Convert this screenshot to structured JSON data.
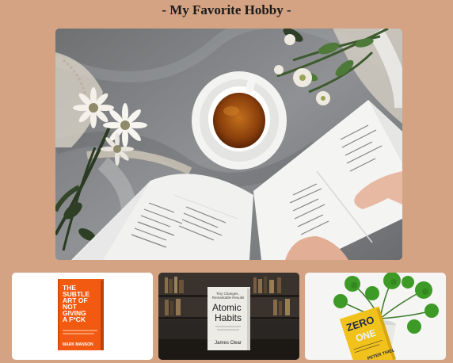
{
  "page": {
    "title": "- My Favorite Hobby -"
  },
  "hero": {
    "image": "reading-book-with-tea-photo"
  },
  "books": [
    {
      "image": "subtle-art-book-cover",
      "title_lines": [
        "THE",
        "SUBTLE",
        "ART OF",
        "NOT",
        "GIVING",
        "A F*CK"
      ],
      "author": "MARK MANSON",
      "cover_color": "#f25a12"
    },
    {
      "image": "atomic-habits-book-cover",
      "tagline_lines": [
        "Tiny Changes,",
        "Remarkable Results"
      ],
      "title_lines": [
        "Atomic",
        "Habits"
      ],
      "author": "James Clear"
    },
    {
      "image": "zero-to-one-book-cover",
      "title_lines": [
        "ZERO",
        "ONE"
      ],
      "author": "PETER THIEL",
      "cover_color": "#f2c21c"
    }
  ]
}
